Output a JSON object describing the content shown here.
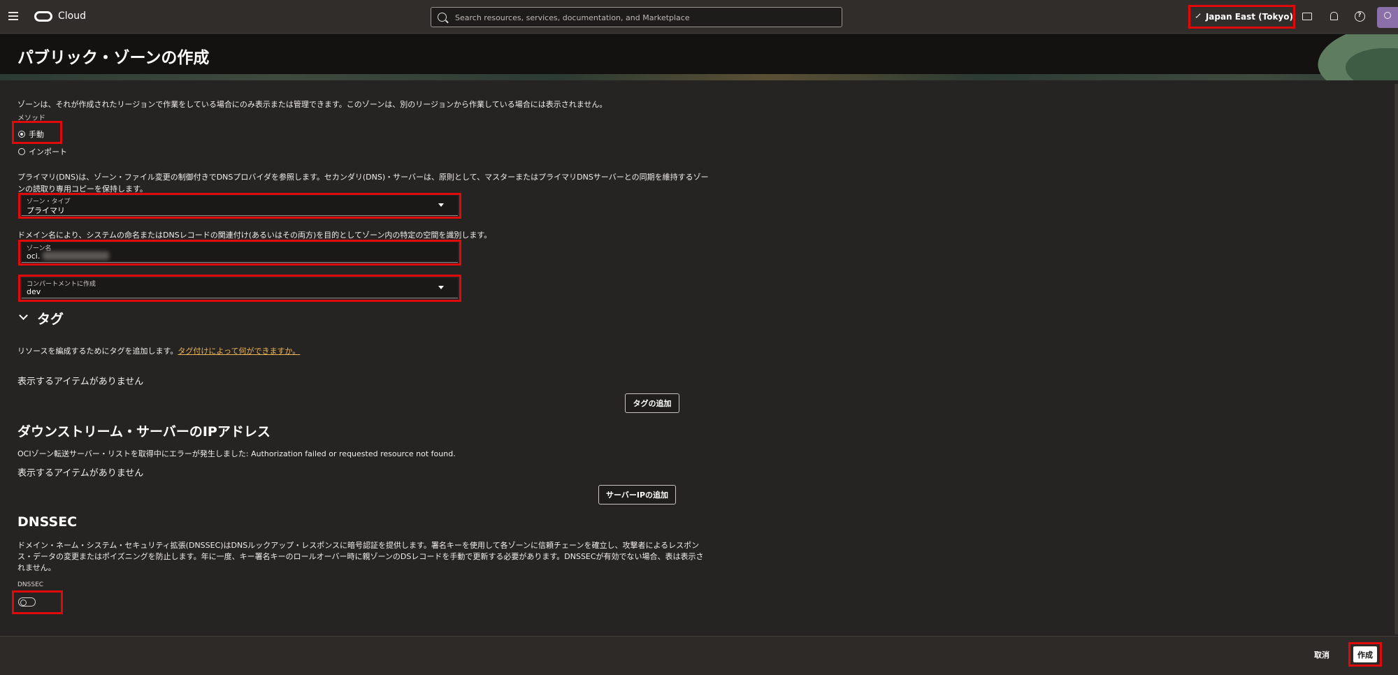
{
  "topbar": {
    "brand": "Cloud",
    "search_placeholder": "Search resources, services, documentation, and Marketplace",
    "region": "Japan East (Tokyo)"
  },
  "page": {
    "title": "パブリック・ゾーンの作成"
  },
  "form": {
    "region_note": "ゾーンは、それが作成されたリージョンで作業をしている場合にのみ表示または管理できます。このゾーンは、別のリージョンから作業している場合には表示されません。",
    "method_label": "メソッド",
    "method_options": [
      "手動",
      "インポート"
    ],
    "method_selected": "手動",
    "zone_type_desc_line1": "プライマリ(DNS)は、ゾーン・ファイル変更の制御付きでDNSプロバイダを参照します。セカンダリ(DNS)・サーバーは、原則として、マスターまたはプライマリDNSサーバーとの同期を維持するゾー",
    "zone_type_desc_line2": "ンの読取り専用コピーを保持します。",
    "zone_type_label": "ゾーン・タイプ",
    "zone_type_value": "プライマリ",
    "zone_name_desc": "ドメイン名により、システムの命名またはDNSレコードの関連付け(あるいはその両方)を目的としてゾーン内の特定の空間を識別します。",
    "zone_name_label": "ゾーン名",
    "zone_name_value": "oci.",
    "compartment_label": "コンパートメントに作成",
    "compartment_value": "dev"
  },
  "tags": {
    "heading": "タグ",
    "desc": "リソースを編成するためにタグを追加します。",
    "link": "タグ付けによって何ができますか。",
    "empty": "表示するアイテムがありません",
    "add_button": "タグの追加"
  },
  "downstream": {
    "heading": "ダウンストリーム・サーバーのIPアドレス",
    "error": "OCIゾーン転送サーバー・リストを取得中にエラーが発生しました: Authorization failed or requested resource not found.",
    "empty": "表示するアイテムがありません",
    "add_button": "サーバーIPの追加"
  },
  "dnssec": {
    "heading": "DNSSEC",
    "desc_line1": "ドメイン・ネーム・システム・セキュリティ拡張(DNSSEC)はDNSルックアップ・レスポンスに暗号認証を提供します。署名キーを使用して各ゾーンに信頼チェーンを確立し、攻撃者によるレスポン",
    "desc_line2": "ス・データの変更またはポイズニングを防止します。年に一度、キー署名キーのロールオーバー時に親ゾーンのDSレコードを手動で更新する必要があります。DNSSECが有効でない場合、表は表示さ",
    "desc_line3": "れません。",
    "toggle_label": "DNSSEC",
    "enabled": false
  },
  "footer": {
    "cancel": "取消",
    "create": "作成"
  },
  "colors": {
    "highlight": "#e10a0a",
    "link": "#e9b457",
    "avatar": "#8a6fa8"
  }
}
